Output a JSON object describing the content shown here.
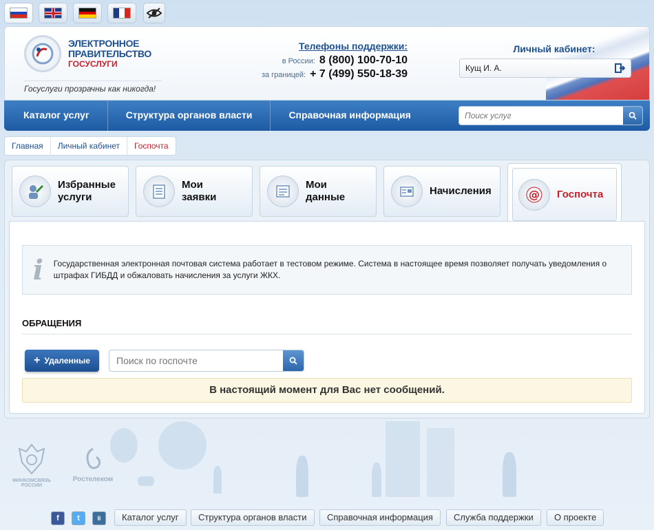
{
  "languages": [
    {
      "name": "Русский",
      "code": "ru"
    },
    {
      "name": "English",
      "code": "en"
    },
    {
      "name": "Deutsch",
      "code": "de"
    },
    {
      "name": "Français",
      "code": "fr"
    }
  ],
  "header": {
    "logo": {
      "line1": "ЭЛЕКТРОННОЕ",
      "line2": "ПРАВИТЕЛЬСТВО",
      "line3": "ГОСУСЛУГИ"
    },
    "slogan": "Госуслуги прозрачны как никогда!",
    "phones": {
      "title": "Телефоны поддержки:",
      "russia_label": "в России:",
      "russia_number": "8 (800) 100-70-10",
      "abroad_label": "за границей:",
      "abroad_number": "+ 7 (499) 550-18-39"
    },
    "cabinet": {
      "title": "Личный кабинет:",
      "user": "Кущ И. А."
    }
  },
  "nav": {
    "items": [
      "Каталог услуг",
      "Структура органов власти",
      "Справочная информация"
    ],
    "search_placeholder": "Поиск услуг"
  },
  "breadcrumbs": [
    "Главная",
    "Личный кабинет",
    "Госпочта"
  ],
  "tabs": [
    {
      "line1": "Избранные",
      "line2": "услуги",
      "icon": "favorites-icon"
    },
    {
      "line1": "Мои",
      "line2": "заявки",
      "icon": "checklist-icon"
    },
    {
      "line1": "Мои",
      "line2": "данные",
      "icon": "data-icon"
    },
    {
      "line1": "Начисления",
      "line2": "",
      "icon": "charges-icon"
    },
    {
      "line1": "Госпочта",
      "line2": "",
      "icon": "at-icon"
    }
  ],
  "info": {
    "icon": "i",
    "text": "Государственная электронная почтовая система работает в тестовом режиме. Система в настоящее время позволяет получать уведомления о штрафах ГИБДД и обжаловать начисления за услуги ЖКХ."
  },
  "section_title": "ОБРАЩЕНИЯ",
  "deleted_button": "Удаленные",
  "mail_search_placeholder": "Поиск по госпочте",
  "empty_message": "В настоящий момент для Вас нет сообщений.",
  "footer": {
    "logos": {
      "ministry_line1": "МИНКОМСВЯЗЬ",
      "ministry_line2": "РОССИИ",
      "rostelecom": "Ростелеком"
    },
    "social": [
      "f",
      "t",
      "li"
    ],
    "links": [
      "Каталог услуг",
      "Структура органов власти",
      "Справочная информация",
      "Служба поддержки",
      "О проекте"
    ]
  },
  "colors": {
    "brand_blue": "#1d4f91",
    "accent_red": "#c8202a",
    "nav_blue": "#2b6bb4",
    "notice_bg": "#fcf7e2"
  }
}
